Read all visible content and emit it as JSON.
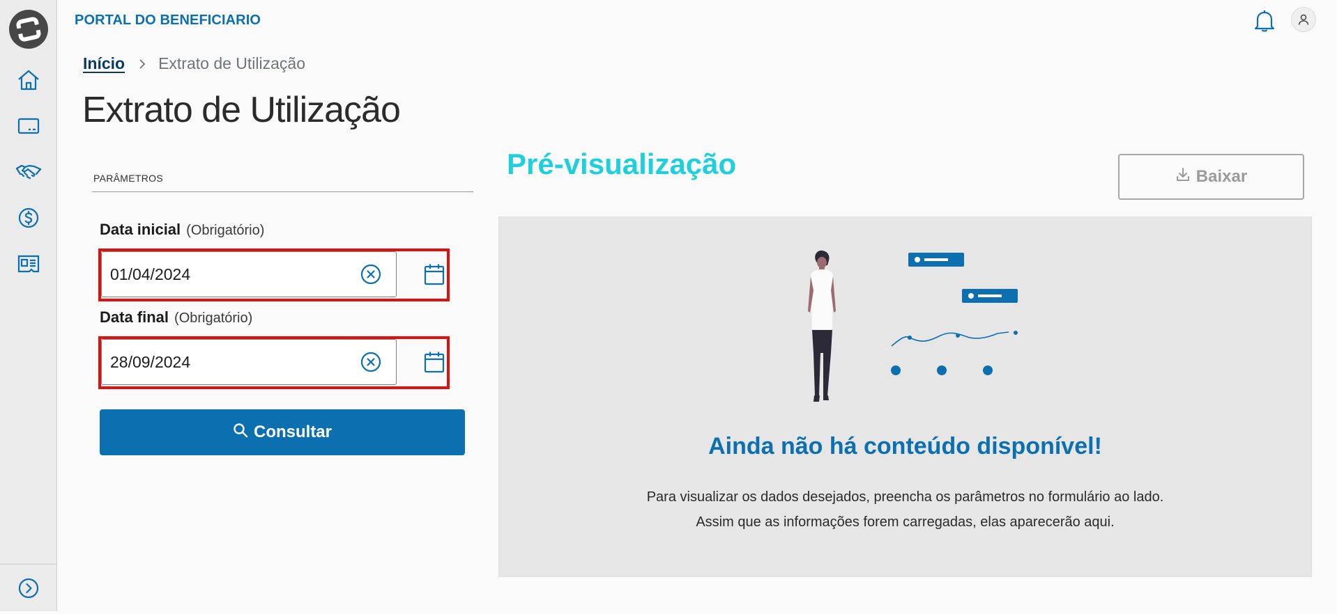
{
  "header": {
    "app_title": "PORTAL DO BENEFICIARIO",
    "icons": {
      "bell": "bell-icon",
      "avatar": "user-icon"
    }
  },
  "sidebar": {
    "logo": "totvs-logo",
    "items": [
      {
        "icon": "home-icon"
      },
      {
        "icon": "card-icon"
      },
      {
        "icon": "handshake-icon"
      },
      {
        "icon": "dollar-icon"
      },
      {
        "icon": "id-card-icon"
      }
    ],
    "expand_icon": "chevron-right-circle-icon"
  },
  "breadcrumb": {
    "home": "Início",
    "current": "Extrato de Utilização"
  },
  "page_title": "Extrato de Utilização",
  "params": {
    "section_label": "PARÂMETROS",
    "start_date": {
      "label": "Data inicial",
      "required": "(Obrigatório)",
      "value": "01/04/2024"
    },
    "end_date": {
      "label": "Data final",
      "required": "(Obrigatório)",
      "value": "28/09/2024"
    },
    "submit_label": "Consultar"
  },
  "preview": {
    "title": "Pré-visualização",
    "download_label": "Baixar",
    "empty_title": "Ainda não há conteúdo disponível!",
    "empty_description": "Para visualizar os dados desejados, preencha os parâmetros no formulário ao lado. Assim que as informações forem carregadas, elas aparecerão aqui."
  },
  "colors": {
    "primary": "#0c6fb0",
    "accent": "#1fcfdc",
    "highlight_border": "#e01010",
    "sidebar_bg": "#ebebeb"
  }
}
